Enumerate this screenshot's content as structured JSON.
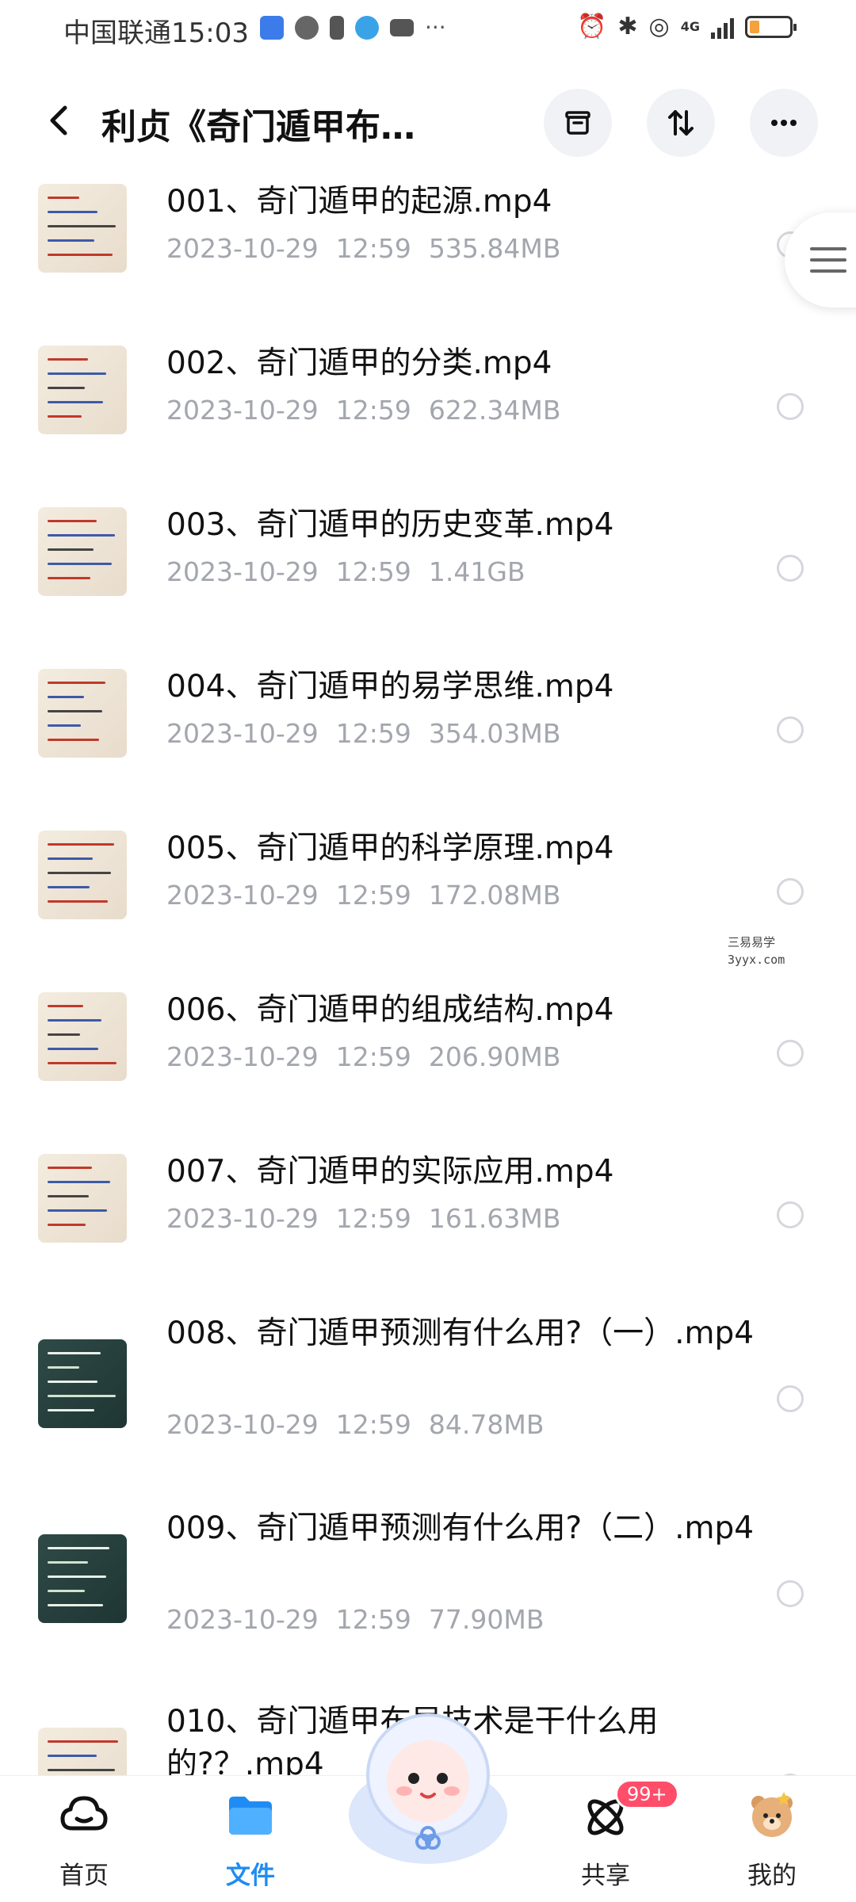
{
  "status_bar": {
    "carrier": "中国联通",
    "time": "15:03",
    "network": "4G",
    "battery_level": 0.25
  },
  "header": {
    "title": "利贞《奇门遁甲布…",
    "back_icon": "chevron-left-icon",
    "actions": [
      {
        "name": "archive-icon"
      },
      {
        "name": "sort-icon"
      },
      {
        "name": "more-icon"
      }
    ]
  },
  "files": [
    {
      "name": "001、奇门遁甲的起源.mp4",
      "date": "2023-10-29",
      "time": "12:59",
      "size": "535.84MB",
      "thumb": "paper"
    },
    {
      "name": "002、奇门遁甲的分类.mp4",
      "date": "2023-10-29",
      "time": "12:59",
      "size": "622.34MB",
      "thumb": "paper"
    },
    {
      "name": "003、奇门遁甲的历史变革.mp4",
      "date": "2023-10-29",
      "time": "12:59",
      "size": "1.41GB",
      "thumb": "paper"
    },
    {
      "name": "004、奇门遁甲的易学思维.mp4",
      "date": "2023-10-29",
      "time": "12:59",
      "size": "354.03MB",
      "thumb": "paper"
    },
    {
      "name": "005、奇门遁甲的科学原理.mp4",
      "date": "2023-10-29",
      "time": "12:59",
      "size": "172.08MB",
      "thumb": "paper"
    },
    {
      "name": "006、奇门遁甲的组成结构.mp4",
      "date": "2023-10-29",
      "time": "12:59",
      "size": "206.90MB",
      "thumb": "paper"
    },
    {
      "name": "007、奇门遁甲的实际应用.mp4",
      "date": "2023-10-29",
      "time": "12:59",
      "size": "161.63MB",
      "thumb": "paper"
    },
    {
      "name": "008、奇门遁甲预测有什么用?（一）.mp4",
      "date": "2023-10-29",
      "time": "12:59",
      "size": "84.78MB",
      "thumb": "board"
    },
    {
      "name": "009、奇门遁甲预测有什么用?（二）.mp4",
      "date": "2023-10-29",
      "time": "12:59",
      "size": "77.90MB",
      "thumb": "board"
    },
    {
      "name": "010、奇门遁甲布局技术是干什么用的?？.mp4",
      "date": "",
      "time": "",
      "size": "",
      "thumb": "paper"
    }
  ],
  "watermark": {
    "line1": "三易易学",
    "line2": "3yyx.com"
  },
  "bottom_nav": [
    {
      "label": "首页",
      "icon": "cloud-icon",
      "active": false
    },
    {
      "label": "文件",
      "icon": "folder-icon",
      "active": true
    },
    {
      "label": "共享",
      "icon": "atom-icon",
      "active": false,
      "badge": "99+"
    },
    {
      "label": "我的",
      "icon": "bear-avatar-icon",
      "active": false
    }
  ],
  "colors": {
    "accent": "#1f8cf3",
    "meta_text": "#a3a6ad",
    "badge": "#ff4d6a",
    "battery": "#f4a23b"
  }
}
